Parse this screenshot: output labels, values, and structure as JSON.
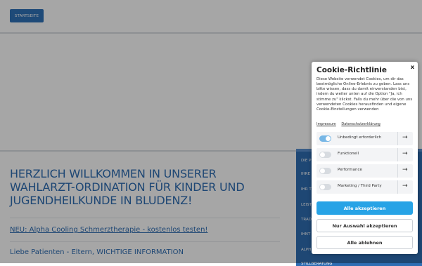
{
  "header": {
    "home_label": "STARTSEITE"
  },
  "main": {
    "welcome_title": "Herzlich Willkommen in unserer Wahlarzt-Ordination für Kinder und Jugendheilkunde in Bludenz!",
    "news_link": "NEU: Alpha Cooling Schmerztherapie - kostenlos testen!",
    "notice": "Liebe Patienten - Eltern, WICHTIGE INFORMATION"
  },
  "sidenav": {
    "items": [
      "Die P",
      "Ihre",
      "Ihr T",
      "Leist",
      "Trad",
      "Ihnt",
      "Alph",
      "Stillberatung"
    ]
  },
  "cookie": {
    "title": "Cookie-Richtlinie",
    "close_label": "x",
    "text": "Diese Website verwendet Cookies, um dir das bestmögliche Online-Erlebnis zu geben. Lass uns bitte wissen, dass du damit einverstanden bist, indem du weiter unten auf die Option \"Ja, ich stimme zu\" klickst. Falls du mehr über die von uns verwendeten Cookies herausfinden und eigene Cookie-Einstellungen verwenden",
    "links": {
      "impressum": "Impressum",
      "datenschutz": "Datenschutzerklärung"
    },
    "categories": [
      {
        "label": "Unbedingt erforderlich",
        "enabled": true
      },
      {
        "label": "Funktionell",
        "enabled": false
      },
      {
        "label": "Performance",
        "enabled": false
      },
      {
        "label": "Marketing / Third Party",
        "enabled": false
      }
    ],
    "arrow_glyph": "→",
    "buttons": {
      "accept_all": "Alle akzeptieren",
      "accept_selection": "Nur Auswahl akzeptieren",
      "reject_all": "Alle ablehnen"
    }
  },
  "colors": {
    "brand_blue": "#2f6db3",
    "accept_blue": "#27a3e6",
    "toggle_on": "#77b7e6"
  }
}
